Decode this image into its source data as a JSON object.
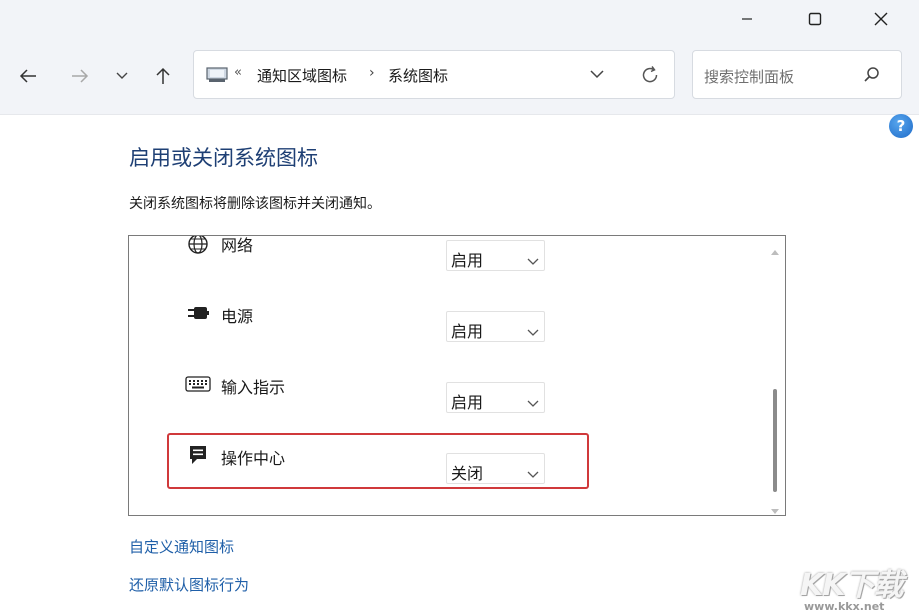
{
  "window": {
    "minimize_icon": "minimize-icon",
    "maximize_icon": "maximize-icon",
    "close_icon": "close-icon"
  },
  "nav": {
    "address": {
      "overflow": "«",
      "crumbs": [
        "通知区域图标",
        "系统图标"
      ],
      "separator": "›"
    },
    "search_placeholder": "搜索控制面板"
  },
  "help_label": "?",
  "page": {
    "title": "启用或关闭系统图标",
    "description": "关闭系统图标将删除该图标并关闭通知。"
  },
  "icons_list": [
    {
      "icon": "globe-icon",
      "label": "网络",
      "value": "启用"
    },
    {
      "icon": "power-plug-icon",
      "label": "电源",
      "value": "启用"
    },
    {
      "icon": "keyboard-icon",
      "label": "输入指示",
      "value": "启用"
    },
    {
      "icon": "action-center-icon",
      "label": "操作中心",
      "value": "关闭",
      "highlighted": true
    }
  ],
  "links": {
    "customize": "自定义通知图标",
    "restore": "还原默认图标行为"
  },
  "watermark": {
    "logo": "KK下载",
    "url": "www.kkx.net"
  },
  "colors": {
    "title": "#1e3f74",
    "link": "#1f5fa8",
    "highlight_border": "#d0393b",
    "chrome_bg": "#f2f4f8"
  }
}
